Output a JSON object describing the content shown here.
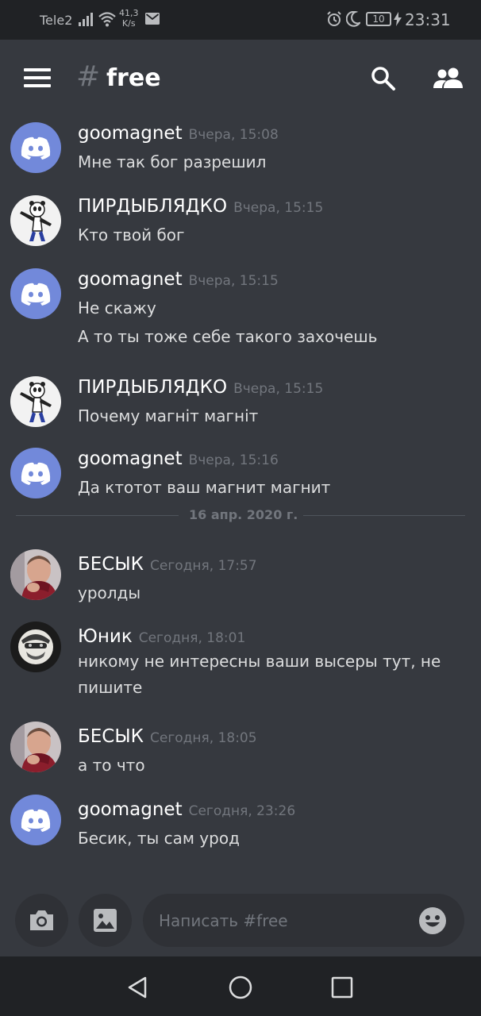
{
  "status_bar": {
    "carrier": "Tele2",
    "net_speed_value": "41,3",
    "net_speed_unit": "K/s",
    "battery": "10",
    "time": "23:31"
  },
  "header": {
    "hash_symbol": "#",
    "channel": "free"
  },
  "messages": [
    {
      "author": "goomagnet",
      "time": "Вчера, 15:08",
      "avatar": "discord-logo-icon",
      "lines": [
        "Мне так бог разрешил"
      ]
    },
    {
      "author": "ПИРДЫБЛЯДКО",
      "time": "Вчера, 15:15",
      "avatar": "panda-dab-avatar",
      "lines": [
        "Кто твой бог"
      ]
    },
    {
      "author": "goomagnet",
      "time": "Вчера, 15:15",
      "avatar": "discord-logo-icon",
      "lines": [
        "Не скажу",
        "А то ты тоже себе такого захочешь"
      ]
    },
    {
      "author": "ПИРДЫБЛЯДКО",
      "time": "Вчера, 15:15",
      "avatar": "panda-dab-avatar",
      "lines": [
        "Почему магніт магніт"
      ]
    },
    {
      "author": "goomagnet",
      "time": "Вчера, 15:16",
      "avatar": "discord-logo-icon",
      "lines": [
        "Да ктотот ваш магнит магнит"
      ]
    },
    {
      "author": "БЕСЫК",
      "time": "Сегодня, 17:57",
      "avatar": "person-photo-avatar",
      "lines": [
        "уролды"
      ]
    },
    {
      "author": "Юник",
      "time": "Сегодня, 18:01",
      "avatar": "masked-character-avatar",
      "lines": [
        "никому не интересны ваши высеры тут, не",
        "пишите"
      ]
    },
    {
      "author": "БЕСЫК",
      "time": "Сегодня, 18:05",
      "avatar": "person-photo-avatar",
      "lines": [
        "а то что"
      ]
    },
    {
      "author": "goomagnet",
      "time": "Сегодня, 23:26",
      "avatar": "discord-logo-icon",
      "lines": [
        "Бесик, ты сам урод"
      ]
    }
  ],
  "date_divider": "16 апр. 2020 г.",
  "composer": {
    "placeholder": "Написать #free"
  },
  "colors": {
    "background": "#36393f",
    "bars": "#202225",
    "blurple": "#7289da",
    "timestamp": "#72767d"
  }
}
